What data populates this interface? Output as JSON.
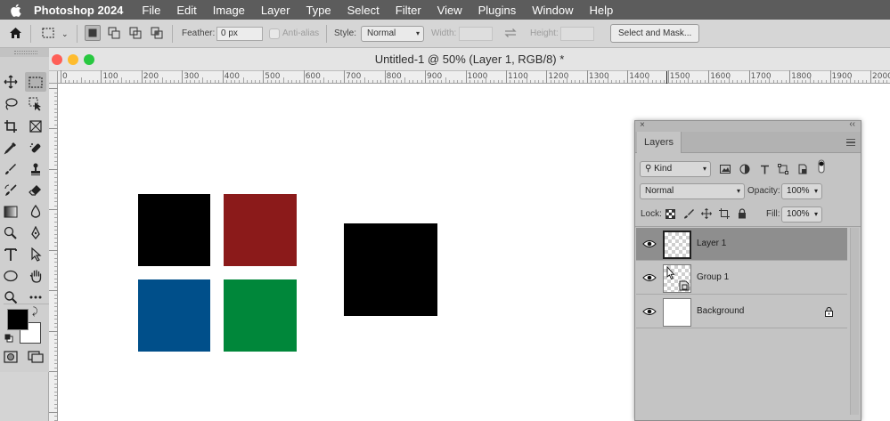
{
  "menubar": {
    "app_name": "Photoshop 2024",
    "items": [
      "File",
      "Edit",
      "Image",
      "Layer",
      "Type",
      "Select",
      "Filter",
      "View",
      "Plugins",
      "Window",
      "Help"
    ]
  },
  "options_bar": {
    "feather_label": "Feather:",
    "feather_value": "0 px",
    "antialias_label": "Anti-alias",
    "style_label": "Style:",
    "style_value": "Normal",
    "width_label": "Width:",
    "height_label": "Height:",
    "select_mask_label": "Select and Mask..."
  },
  "document": {
    "title": "Untitled-1 @ 50% (Layer 1, RGB/8) *",
    "ruler_labels": [
      "0",
      "100",
      "200",
      "300",
      "400",
      "500",
      "600",
      "700",
      "800",
      "900",
      "1000",
      "1100",
      "1200",
      "1300",
      "1400",
      "1500",
      "1600",
      "1700",
      "1800",
      "1900",
      "2000"
    ],
    "shapes": [
      {
        "name": "black-square",
        "color": "#000000"
      },
      {
        "name": "red-square",
        "color": "#8b1a1a"
      },
      {
        "name": "blue-square",
        "color": "#004f8a"
      },
      {
        "name": "green-square",
        "color": "#00873a"
      },
      {
        "name": "large-black-square",
        "color": "#000000"
      }
    ]
  },
  "layers_panel": {
    "tab_label": "Layers",
    "filter_value": "Kind",
    "blend_mode": "Normal",
    "opacity_label": "Opacity:",
    "opacity_value": "100%",
    "lock_label": "Lock:",
    "fill_label": "Fill:",
    "fill_value": "100%",
    "layers": [
      {
        "name": "Layer 1",
        "selected": true
      },
      {
        "name": "Group 1",
        "selected": false
      },
      {
        "name": "Background",
        "selected": false,
        "locked": true
      }
    ]
  },
  "colors": {
    "foreground": "#000000",
    "background": "#ffffff",
    "menubar": "#5c5c5c"
  }
}
